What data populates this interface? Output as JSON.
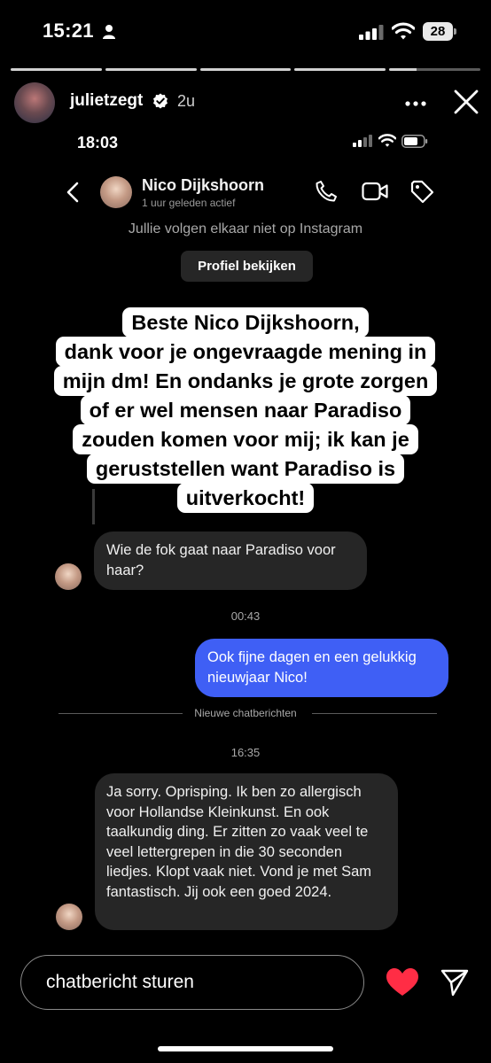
{
  "status_bar": {
    "time": "15:21",
    "battery": "28"
  },
  "story": {
    "username": "julietzegt",
    "age": "2u",
    "progress_segments": 5,
    "current_segment_fraction": 0.3
  },
  "inner_screenshot": {
    "status_time": "18:03",
    "chat": {
      "contact_name": "Nico Dijkshoorn",
      "contact_status": "1 uur geleden actief",
      "follow_note": "Jullie volgen elkaar niet op Instagram",
      "profile_button": "Profiel bekijken"
    }
  },
  "overlay_lines": [
    "Beste Nico Dijkshoorn,",
    "dank voor je ongevraagde mening in",
    "mijn dm! En ondanks je grote zorgen",
    "of er wel mensen naar Paradiso",
    "zouden komen voor mij;  ik kan je",
    "geruststellen want Paradiso is",
    "uitverkocht!"
  ],
  "messages": [
    {
      "direction": "in",
      "text": "Wie de fok gaat naar Paradiso voor haar?"
    },
    {
      "timestamp": "00:43"
    },
    {
      "direction": "out",
      "text": "Ook fijne dagen en een gelukkig nieuwjaar Nico!"
    },
    {
      "divider": "Nieuwe chatberichten"
    },
    {
      "timestamp": "16:35"
    },
    {
      "direction": "in",
      "text": "Ja sorry. Oprisping. Ik ben zo allergisch voor Hollandse Kleinkunst. En ook taalkundig ding. Er zitten zo vaak veel te veel lettergrepen in die 30 seconden liedjes. Klopt vaak niet. Vond je met Sam fantastisch. Jij ook een goed 2024."
    }
  ],
  "reply": {
    "placeholder": "chatbericht sturen"
  },
  "colors": {
    "accent_blue": "#3f5ff5",
    "heart": "#ff2d45",
    "bubble_gray": "#262626"
  },
  "icons": [
    "person-icon",
    "signal-icon",
    "wifi-icon",
    "verified-icon",
    "more-icon",
    "close-icon",
    "back-icon",
    "call-icon",
    "video-icon",
    "tag-icon",
    "heart-icon",
    "send-icon"
  ]
}
